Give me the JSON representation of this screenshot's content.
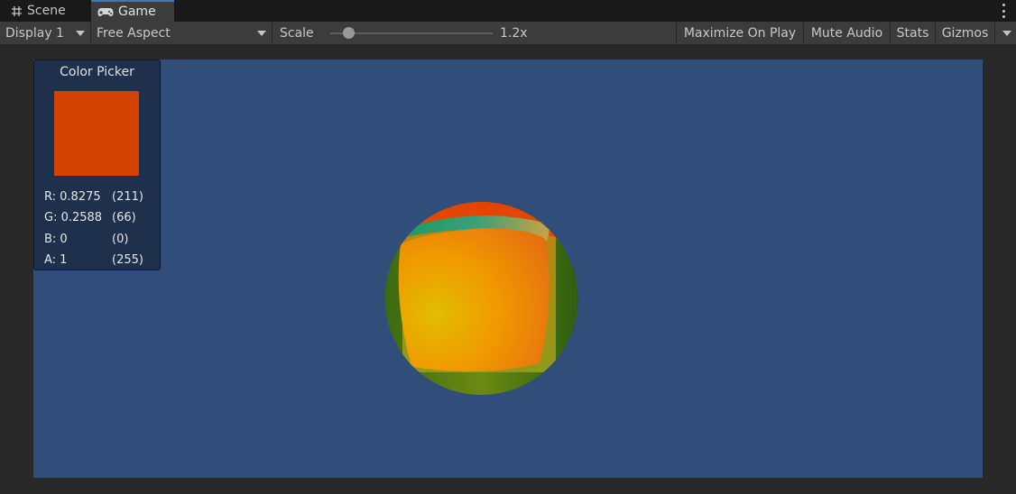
{
  "tabs": {
    "scene_label": "Scene",
    "game_label": "Game"
  },
  "toolbar": {
    "display": "Display 1",
    "aspect": "Free Aspect",
    "scale_label": "Scale",
    "scale_value": "1.2x",
    "scale_slider_fraction": 0.08,
    "maximize": "Maximize On Play",
    "mute": "Mute Audio",
    "stats": "Stats",
    "gizmos": "Gizmos"
  },
  "picker": {
    "title": "Color Picker",
    "swatch_color": "#d34200",
    "rows": [
      {
        "key": "R: 0.8275",
        "val": "(211)"
      },
      {
        "key": "G: 0.2588",
        "val": "(66)"
      },
      {
        "key": "B: 0",
        "val": "(0)"
      },
      {
        "key": "A: 1",
        "val": "(255)"
      }
    ]
  },
  "colors": {
    "viewport_bg": "#314d7a",
    "accent": "#3a79bb"
  }
}
